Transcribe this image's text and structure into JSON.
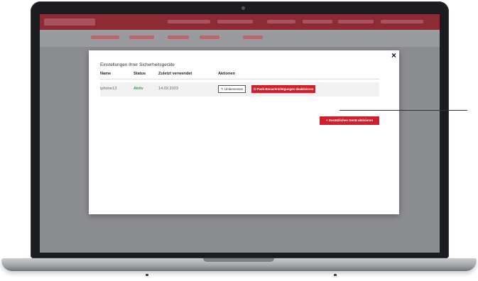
{
  "modal": {
    "title": "Einstellungen Ihrer Sicherheitsgeräte",
    "close_label": "×",
    "columns": [
      "Name",
      "Status",
      "Zuletzt verwendet",
      "Aktionen"
    ],
    "rows": [
      {
        "name": "Iphone13",
        "status": "Aktiv",
        "last_used": "14.02.2023",
        "rename_label": "Umbenennen",
        "push_label": "Push-Benachrichtigungen deaktivieren"
      }
    ],
    "add_device_label": "Zusätzliches Gerät aktivieren"
  },
  "colors": {
    "accent_red": "#d0202e",
    "status_green": "#3aa14a"
  }
}
